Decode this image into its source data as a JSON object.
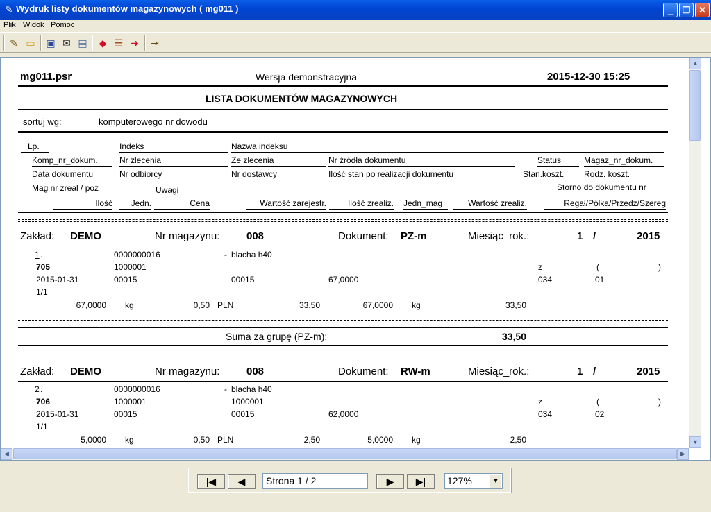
{
  "window": {
    "title": "Wydruk listy dokumentów magazynowych  ( mg011 )",
    "min": "_",
    "max": "❐",
    "close": "✕"
  },
  "menu": [
    "Plik",
    "Widok",
    "Pomoc"
  ],
  "toolbar_icons": [
    "edit-icon",
    "open-folder-icon",
    "save-icon",
    "email-icon",
    "print-icon",
    "arrow-left-icon",
    "list-icon",
    "arrow-right-icon",
    "exit-icon"
  ],
  "report": {
    "file": "mg011.psr",
    "version": "Wersja demonstracyjna",
    "datetime": "2015-12-30  15:25",
    "heading": "LISTA DOKUMENTÓW MAGAZYNOWYCH",
    "sort_label": "sortuj wg:",
    "sort_value": "komputerowego nr dowodu",
    "cols": {
      "lp": "Lp.",
      "indeks": "Indeks",
      "nazwa": "Nazwa indeksu",
      "komp": "Komp_nr_dokum.",
      "nrzlec": "Nr zlecenia",
      "zezlec": "Ze zlecenia",
      "nrzrodla": "Nr źródła dokumentu",
      "status": "Status",
      "magaz": "Magaz_nr_dokum.",
      "data": "Data dokumentu",
      "odbiorcy": "Nr odbiorcy",
      "dostawcy": "Nr dostawcy",
      "ilosc_stan": "Ilość stan po realizacji dokumentu",
      "stankoszt": "Stan.koszt.",
      "rodzkoszt": "Rodz. koszt.",
      "magzreal": "Mag nr zreal / poz",
      "uwagi": "Uwagi",
      "storno": "Storno do dokumentu nr",
      "ilosc": "Ilość",
      "jedn": "Jedn.",
      "cena": "Cena",
      "wartzar": "Wartość zarejestr.",
      "ilosczreal": "Ilość zrealiz.",
      "jednmag": "Jedn_mag",
      "wartzreal": "Wartość zrealiz.",
      "regal": "Regał/Półka/Przedz/Szereg"
    },
    "groups": [
      {
        "zaklad_label": "Zakład:",
        "zaklad": "DEMO",
        "nrmag_label": "Nr magazynu:",
        "nrmag": "008",
        "dok_label": "Dokument:",
        "dok": "PZ-m",
        "mies_label": "Miesiąc_rok.:",
        "mies": "1",
        "slash": "/",
        "rok": "2015",
        "row": {
          "lp": "1",
          "dot": ".",
          "indeks": "0000000016",
          "dash": "-",
          "nazwa": "blacha h40",
          "komp": "705",
          "nrzlec": "1000001",
          "zezlec": "",
          "status": "z",
          "paren_open": "(",
          "paren_close": ")",
          "data": "2015-01-31",
          "odbiorcy": "00015",
          "dostawcy": "00015",
          "stan": "67,0000",
          "stankoszt": "034",
          "rodz": "01",
          "magpoz": "1/1",
          "ilosc": "67,0000",
          "jedn": "kg",
          "cena": "0,50",
          "waluta": "PLN",
          "wartzar": "33,50",
          "ilosczreal": "67,0000",
          "jednmag": "kg",
          "wartzreal": "33,50"
        },
        "sum_label": "Suma za grupę (PZ-m):",
        "sum": "33,50"
      },
      {
        "zaklad_label": "Zakład:",
        "zaklad": "DEMO",
        "nrmag_label": "Nr magazynu:",
        "nrmag": "008",
        "dok_label": "Dokument:",
        "dok": "RW-m",
        "mies_label": "Miesiąc_rok.:",
        "mies": "1",
        "slash": "/",
        "rok": "2015",
        "row": {
          "lp": "2",
          "dot": ".",
          "indeks": "0000000016",
          "dash": "-",
          "nazwa": "blacha h40",
          "komp": "706",
          "nrzlec": "1000001",
          "zezlec": "1000001",
          "status": "z",
          "paren_open": "(",
          "paren_close": ")",
          "data": "2015-01-31",
          "odbiorcy": "00015",
          "dostawcy": "00015",
          "stan": "62,0000",
          "stankoszt": "034",
          "rodz": "02",
          "magpoz": "1/1",
          "ilosc": "5,0000",
          "jedn": "kg",
          "cena": "0,50",
          "waluta": "PLN",
          "wartzar": "2,50",
          "ilosczreal": "5,0000",
          "jednmag": "kg",
          "wartzreal": "2,50"
        }
      }
    ]
  },
  "nav": {
    "first": "|◀",
    "prev": "◀",
    "page": "Strona  1 / 2",
    "next": "▶",
    "last": "▶|",
    "zoom": "127%",
    "zoom_arrow": "▼"
  }
}
